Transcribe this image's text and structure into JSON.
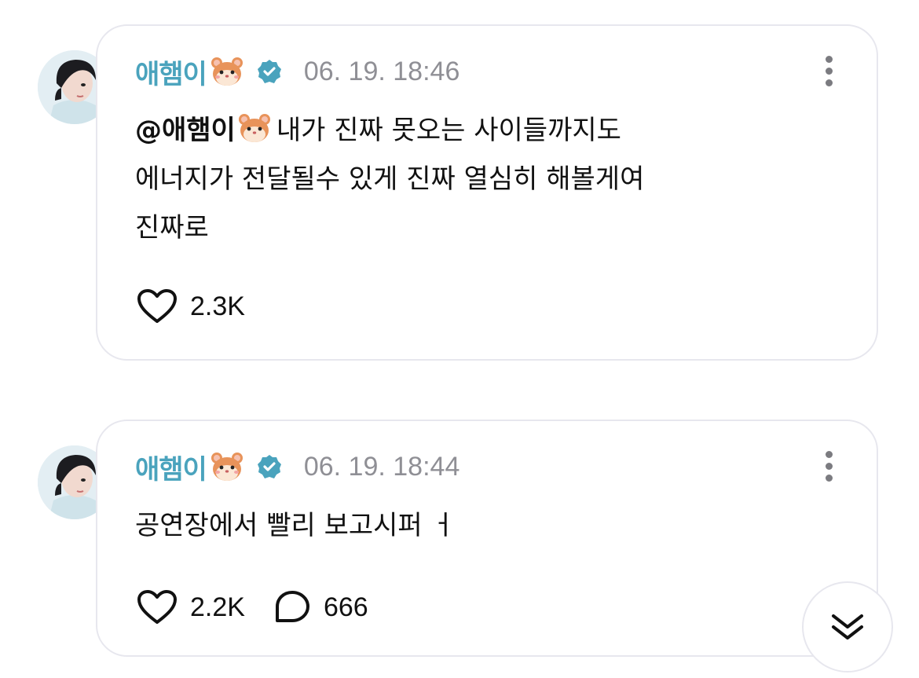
{
  "posts": [
    {
      "author": "애햄이",
      "emoji": "hamster-icon",
      "verified": true,
      "time": "06. 19. 18:46",
      "mention": "@애햄이",
      "lines": [
        "내가 진짜 못오는 사이들까지도",
        "에너지가 전달될수 있게 진짜 열심히 해볼게여",
        "진짜로"
      ],
      "likes": "2.3K"
    },
    {
      "author": "애햄이",
      "emoji": "hamster-icon",
      "verified": true,
      "time": "06. 19. 18:44",
      "text": "공연장에서 빨리 보고시퍼 ㅓ",
      "likes": "2.2K",
      "comments": "666"
    }
  ],
  "colors": {
    "name": "#4aa3bd",
    "time": "#8f8f95",
    "verified": "#4aa3bd",
    "border": "#e7e7ee"
  },
  "icons": {
    "more": "more-vertical-icon",
    "like": "heart-icon",
    "comment": "comment-bubble-icon",
    "scroll": "double-chevron-down-icon",
    "verified": "verified-badge-icon"
  }
}
